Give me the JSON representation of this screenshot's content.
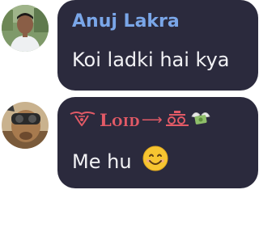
{
  "messages": [
    {
      "sender": "Anuj Lakra",
      "text": "Koi ladki hai kya",
      "name_color": "#7aa6e8"
    },
    {
      "sender_fancy": "Loid",
      "arrow": "⟶",
      "text": "Me hu",
      "emoji": "smiling-face-emoji",
      "name_color": "#e25a66"
    }
  ],
  "colors": {
    "bubble": "#2b2a3d",
    "text": "#f2f2f5",
    "background": "#ffffff"
  }
}
